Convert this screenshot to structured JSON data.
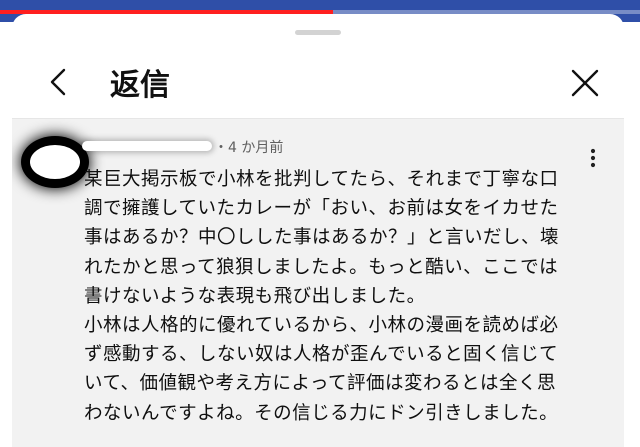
{
  "app": {
    "video_progress": 0.52,
    "colors": {
      "accent": "#ff1f1f",
      "video_bg": "#2f4fa8",
      "text": "#0f0f0f",
      "meta": "#606060"
    }
  },
  "header": {
    "back_icon": "chevron-left-icon",
    "title": "返信",
    "close_icon": "close-icon"
  },
  "comment": {
    "time": "・4 か月前",
    "more_icon": "more-vertical-icon",
    "body": "某巨大掲示板で小林を批判してたら、それまで丁寧な口\n調で擁護していたカレーが「おい、お前は女をイカせた\n事はあるか？中〇しした事はあるか？」と言いだし、壊\nれたかと思って狼狽しましたよ。もっと酷い、ここでは\n書けないような表現も飛び出しました。\n小林は人格的に優れているから、小林の漫画を読めば必\nず感動する、しない奴は人格が歪んでいると固く信じて\nいて、価値観や考え方によって評価は変わるとは全く思\nわないんですよね。その信じる力にドン引きしました。"
  }
}
